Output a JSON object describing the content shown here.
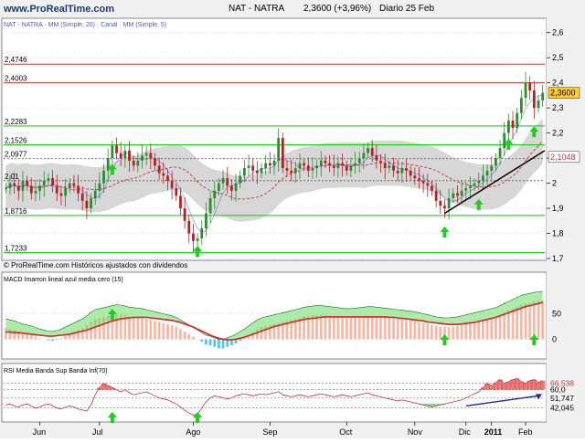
{
  "header": {
    "brand": "www.ProRealTime.com",
    "instrument": "NAT - NATRA",
    "price_line": "2,3600 (+3,96%)",
    "period": "Diario 25 Feb",
    "legend_left": "NAT - NATRA · MM (Simple, 20) · Canal · MM (Simple, 5)"
  },
  "bottom_axis": {
    "months": [
      "Jun",
      "Jul",
      "Ago",
      "Sep",
      "Oct",
      "Nov",
      "Dic",
      "2011",
      "Feb"
    ]
  },
  "colors": {
    "background": "#ffffff",
    "panel_bg": "#ffffff",
    "grid": "#c8c8c8",
    "up_candle": "#2e8b2e",
    "down_candle": "#b22222",
    "ma_long": "#cc3333",
    "ma_short": "#3333cc",
    "band_fill": "#c9c9c9",
    "support_line": "#00cc00",
    "resistance_line": "#cc3333",
    "trend_line": "#000000",
    "arrow": "#22cc22",
    "current_price_tag": "#ffcc33",
    "ma_tag": "#cc3333",
    "macd_hist_pos": "#f4b8a6",
    "macd_hist_neg": "#55c8e8",
    "macd_fill": "#66dd66",
    "rsi_line": "#cc3333",
    "rsi_fill_up": "#dd4444",
    "rsi_fill_down": "#33bb33",
    "rsi_trend": "#2222aa"
  },
  "chart_data": [
    {
      "type": "candlestick",
      "title": "NAT - NATRA",
      "ylim": [
        1.7,
        2.65
      ],
      "yticks": [
        1.7,
        1.8,
        1.9,
        2.0,
        2.1,
        2.2,
        2.3,
        2.4,
        2.5,
        2.6
      ],
      "ytick_labels": [
        "1,7",
        "1,8",
        "1,9",
        "2",
        "2,1",
        "2,2",
        "2,3",
        "2,4",
        "2,5",
        "2,6"
      ],
      "horizontal_levels": [
        {
          "value": 2.4746,
          "label": "2,4746",
          "color": "#cc3333"
        },
        {
          "value": 2.4003,
          "label": "2,4003",
          "color": "#cc3333"
        },
        {
          "value": 2.2283,
          "label": "2,2283",
          "color": "#00cc00"
        },
        {
          "value": 2.1526,
          "label": "2,1526",
          "color": "#00cc00"
        },
        {
          "value": 2.0977,
          "label": "2,0977",
          "color": "#555555"
        },
        {
          "value": 2.01,
          "label": "2,01",
          "color": "#555555"
        },
        {
          "value": 1.8716,
          "label": "1,8716",
          "color": "#00cc00"
        },
        {
          "value": 1.7233,
          "label": "1,7233",
          "color": "#00cc00"
        }
      ],
      "last_price": {
        "value": 2.36,
        "label": "2,3600"
      },
      "ma_value": {
        "value": 2.1048,
        "label": "2,1048"
      },
      "close": [
        1.98,
        2.0,
        1.99,
        1.97,
        2.01,
        1.99,
        1.96,
        1.97,
        1.99,
        2.01,
        2.02,
        1.99,
        1.96,
        1.95,
        1.98,
        2.0,
        1.99,
        1.96,
        1.93,
        1.9,
        1.94,
        1.97,
        2.0,
        2.05,
        2.1,
        2.15,
        2.12,
        2.1,
        2.13,
        2.09,
        2.07,
        2.09,
        2.11,
        2.12,
        2.1,
        2.07,
        2.04,
        2.03,
        2.01,
        1.98,
        1.95,
        1.9,
        1.85,
        1.8,
        1.77,
        1.78,
        1.82,
        1.88,
        1.94,
        1.97,
        2.0,
        2.02,
        1.99,
        1.97,
        2.0,
        2.03,
        2.06,
        2.07,
        2.05,
        2.04,
        2.06,
        2.08,
        2.07,
        2.09,
        2.18,
        2.06,
        2.05,
        2.04,
        2.06,
        2.08,
        2.07,
        2.05,
        2.06,
        2.07,
        2.09,
        2.08,
        2.07,
        2.06,
        2.08,
        2.07,
        2.05,
        2.07,
        2.08,
        2.1,
        2.12,
        2.14,
        2.11,
        2.09,
        2.08,
        2.06,
        2.07,
        2.05,
        2.04,
        2.06,
        2.05,
        2.03,
        2.02,
        2.01,
        2.0,
        1.99,
        1.97,
        1.93,
        1.91,
        1.9,
        1.94,
        1.96,
        1.95,
        1.97,
        1.98,
        1.99,
        2.0,
        2.01,
        2.03,
        2.05,
        2.07,
        2.1,
        2.14,
        2.2,
        2.25,
        2.22,
        2.28,
        2.34,
        2.4,
        2.37,
        2.3,
        2.33,
        2.36
      ],
      "arrows_at_index": [
        25,
        45,
        103,
        111,
        118,
        124
      ],
      "trend_line": {
        "from": [
          103,
          1.88
        ],
        "to": [
          127,
          2.09
        ]
      }
    },
    {
      "type": "area",
      "title": "",
      "ylabel": "",
      "ylim": [
        -35,
        110
      ],
      "yticks": [
        0,
        50
      ],
      "ytick_labels": [
        "0",
        "50"
      ],
      "macd": [
        22,
        20,
        18,
        15,
        12,
        10,
        8,
        5,
        2,
        0,
        -2,
        -3,
        -1,
        2,
        6,
        10,
        14,
        18,
        22,
        28,
        35,
        40,
        42,
        44,
        46,
        48,
        50,
        49,
        47,
        45,
        44,
        43,
        42,
        40,
        38,
        36,
        34,
        32,
        30,
        28,
        25,
        20,
        15,
        10,
        5,
        0,
        -5,
        -10,
        -12,
        -15,
        -18,
        -18,
        -15,
        -12,
        -8,
        -3,
        2,
        8,
        14,
        20,
        24,
        26,
        28,
        30,
        32,
        34,
        36,
        38,
        40,
        42,
        45,
        46,
        47,
        48,
        48,
        47,
        46,
        45,
        44,
        43,
        42,
        42,
        43,
        44,
        45,
        46,
        46,
        45,
        44,
        43,
        42,
        41,
        40,
        39,
        38,
        37,
        36,
        34,
        32,
        30,
        28,
        26,
        25,
        24,
        24,
        25,
        26,
        28,
        30,
        32,
        34,
        36,
        38,
        40,
        42,
        44,
        48,
        52,
        56,
        60,
        64,
        68,
        70,
        72,
        74,
        75,
        76
      ],
      "smooth": [
        14,
        14,
        13,
        13,
        12,
        11,
        10,
        9,
        8,
        7,
        6,
        6,
        7,
        8,
        9,
        10,
        12,
        14,
        16,
        18,
        21,
        24,
        27,
        30,
        33,
        36,
        38,
        40,
        41,
        42,
        43,
        43,
        43,
        43,
        42,
        41,
        40,
        39,
        38,
        37,
        35,
        33,
        30,
        27,
        24,
        20,
        16,
        12,
        8,
        5,
        2,
        0,
        -1,
        -1,
        0,
        2,
        4,
        7,
        10,
        13,
        16,
        19,
        22,
        25,
        27,
        29,
        31,
        33,
        35,
        37,
        39,
        40,
        41,
        42,
        43,
        44,
        44,
        44,
        44,
        44,
        44,
        44,
        44,
        44,
        44,
        44,
        44,
        44,
        44,
        44,
        43,
        43,
        42,
        41,
        40,
        39,
        38,
        37,
        36,
        34,
        33,
        32,
        31,
        30,
        29,
        29,
        29,
        30,
        31,
        32,
        33,
        35,
        37,
        39,
        41,
        43,
        46,
        49,
        52,
        55,
        58,
        61,
        64,
        66,
        68,
        70,
        72
      ],
      "arrows_at_index": [
        25,
        103,
        124
      ]
    },
    {
      "type": "line",
      "title": "RSI Media Banda Sup Banda Inf(70)",
      "ylim": [
        30,
        75
      ],
      "yticks": [
        42.045,
        51.747,
        60.0,
        66.538
      ],
      "ytick_labels": [
        "42,045",
        "51,747",
        "60,0",
        "66,538"
      ],
      "rsi": [
        45,
        46,
        44,
        43,
        45,
        46,
        44,
        42,
        43,
        45,
        46,
        44,
        42,
        41,
        43,
        44,
        43,
        41,
        40,
        39,
        45,
        55,
        62,
        66,
        64,
        62,
        60,
        58,
        60,
        57,
        55,
        56,
        57,
        58,
        56,
        54,
        52,
        51,
        50,
        48,
        46,
        43,
        40,
        37,
        35,
        36,
        42,
        48,
        52,
        54,
        53,
        52,
        51,
        52,
        54,
        55,
        56,
        55,
        54,
        55,
        56,
        55,
        56,
        57,
        58,
        55,
        54,
        53,
        54,
        55,
        54,
        53,
        54,
        55,
        56,
        55,
        54,
        53,
        54,
        55,
        54,
        53,
        54,
        55,
        56,
        57,
        55,
        54,
        53,
        52,
        51,
        50,
        49,
        50,
        49,
        48,
        47,
        46,
        45,
        44,
        43,
        44,
        45,
        46,
        47,
        48,
        49,
        50,
        52,
        54,
        56,
        58,
        62,
        66,
        64,
        67,
        70,
        66,
        68,
        70,
        71,
        68,
        66,
        69,
        70,
        67,
        69
      ],
      "media": [
        44.5
      ],
      "band_sup": [
        55.5
      ],
      "band_inf": [
        42.0
      ],
      "arrows_at_index": [
        25,
        45
      ],
      "trend_line": {
        "from": [
          108,
          44.0
        ],
        "to": [
          125,
          54.0
        ]
      }
    }
  ]
}
